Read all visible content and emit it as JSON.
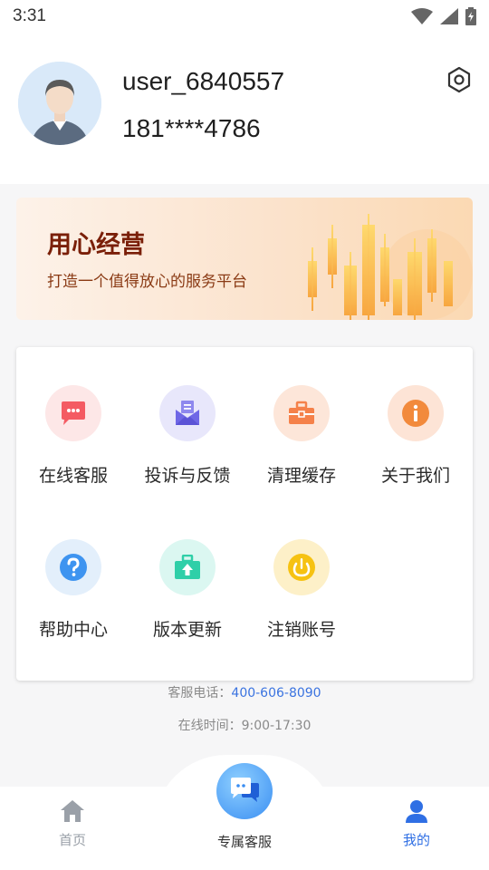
{
  "status_bar": {
    "time": "3:31"
  },
  "profile": {
    "username": "user_6840557",
    "phone": "181****4786"
  },
  "banner": {
    "title": "用心经营",
    "subtitle": "打造一个值得放心的服务平台"
  },
  "menu": {
    "items": [
      {
        "label": "在线客服",
        "icon": "chat-icon",
        "bg": "#fde7e7",
        "color": "#f45b63"
      },
      {
        "label": "投诉与反馈",
        "icon": "mail-icon",
        "bg": "#e8e7fb",
        "color": "#6f67e6"
      },
      {
        "label": "清理缓存",
        "icon": "briefcase-icon",
        "bg": "#fde6d9",
        "color": "#f5814a"
      },
      {
        "label": "关于我们",
        "icon": "info-icon",
        "bg": "#fde4d6",
        "color": "#f28a3c"
      },
      {
        "label": "帮助中心",
        "icon": "question-icon",
        "bg": "#e3effb",
        "color": "#3e94f0"
      },
      {
        "label": "版本更新",
        "icon": "upload-icon",
        "bg": "#dbf7f1",
        "color": "#2fcfa8"
      },
      {
        "label": "注销账号",
        "icon": "power-icon",
        "bg": "#fdf0c8",
        "color": "#f6c212"
      }
    ]
  },
  "footer": {
    "hotline_label": "客服电话：",
    "hotline_number": "400-606-8090",
    "hours": "在线时间：9:00-17:30"
  },
  "tabbar": {
    "home": "首页",
    "service": "专属客服",
    "mine": "我的"
  },
  "colors": {
    "accent": "#3a73e0",
    "tab_inactive": "#9aa0a8",
    "tab_active": "#2f6fe4"
  }
}
